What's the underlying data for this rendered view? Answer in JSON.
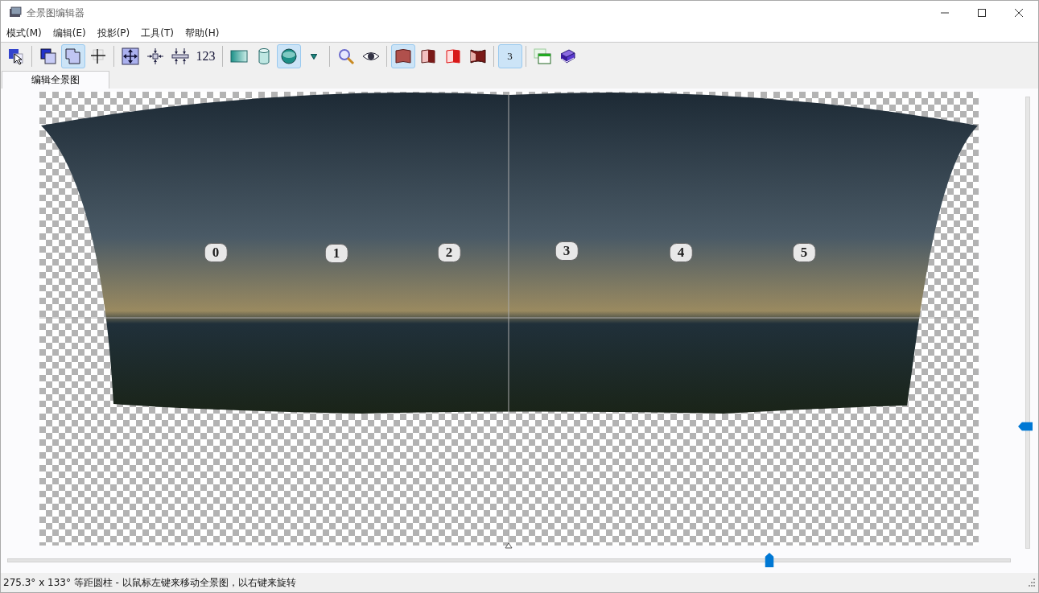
{
  "window": {
    "title": "全景图编辑器"
  },
  "menu": [
    {
      "label": "模式(M)"
    },
    {
      "label": "编辑(E)"
    },
    {
      "label": "投影(P)"
    },
    {
      "label": "工具(T)"
    },
    {
      "label": "帮助(H)"
    }
  ],
  "toolbar": [
    {
      "kind": "pointer",
      "selected": false
    },
    {
      "kind": "sep"
    },
    {
      "kind": "overlap",
      "selected": false
    },
    {
      "kind": "merge",
      "selected": true
    },
    {
      "kind": "cross",
      "selected": false
    },
    {
      "kind": "sep"
    },
    {
      "kind": "fit",
      "selected": false
    },
    {
      "kind": "center",
      "selected": false
    },
    {
      "kind": "straighten",
      "selected": false
    },
    {
      "kind": "text",
      "label": "123",
      "selected": false
    },
    {
      "kind": "sep"
    },
    {
      "kind": "rectangle",
      "selected": false
    },
    {
      "kind": "cylinder",
      "selected": false
    },
    {
      "kind": "sphere",
      "selected": true
    },
    {
      "kind": "dropdown",
      "selected": false
    },
    {
      "kind": "sep"
    },
    {
      "kind": "magnifier",
      "selected": false
    },
    {
      "kind": "eye",
      "selected": false
    },
    {
      "kind": "sep"
    },
    {
      "kind": "sheet",
      "selected": true
    },
    {
      "kind": "sheet-left",
      "selected": false
    },
    {
      "kind": "sheet-right",
      "selected": false
    },
    {
      "kind": "sheet-warp",
      "selected": false
    },
    {
      "kind": "sep"
    },
    {
      "kind": "badge",
      "label": "3",
      "selected": true
    },
    {
      "kind": "sep"
    },
    {
      "kind": "windows",
      "selected": false
    },
    {
      "kind": "book",
      "selected": false
    }
  ],
  "tabs": [
    {
      "label": "编辑全景图",
      "selected": true
    }
  ],
  "images": [
    {
      "label": "0"
    },
    {
      "label": "1"
    },
    {
      "label": "2"
    },
    {
      "label": "3"
    },
    {
      "label": "4"
    },
    {
      "label": "5"
    }
  ],
  "horizontal_slider": {
    "level": 0.76
  },
  "vertical_slider": {
    "level": 0.27
  },
  "status_bar": {
    "text": "275.3° x 133° 等距圆柱 - 以鼠标左键来移动全景图，以右键来旋转"
  }
}
